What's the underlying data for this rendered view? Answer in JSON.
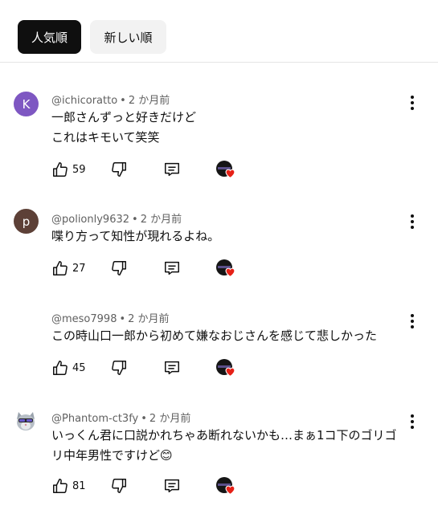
{
  "sort_chips": {
    "top_label": "人気順",
    "newest_label": "新しい順"
  },
  "comments": [
    {
      "avatar_letter": "K",
      "avatar_color": "#7e57c2",
      "handle": "@ichicoratto",
      "time": "2 か月前",
      "lines": [
        "一郎さんずっと好きだけど",
        "これはキモいて笑笑"
      ],
      "likes": "59"
    },
    {
      "avatar_letter": "p",
      "avatar_color": "#5d4037",
      "handle": "@polionly9632",
      "time": "2 か月前",
      "lines": [
        "喋り方って知性が現れるよね。"
      ],
      "likes": "27"
    },
    {
      "avatar_letter": "",
      "avatar_color": "",
      "handle": "@meso7998",
      "time": "2 か月前",
      "lines": [
        "この時山口一郎から初めて嫌なおじさんを感じて悲しかった"
      ],
      "likes": "45"
    },
    {
      "avatar_letter": "",
      "avatar_color": "",
      "handle": "@Phantom-ct3fy",
      "time": "2 か月前",
      "lines": [
        "いっくん君に口説かれちゃあ断れないかも…まぁ1コ下のゴリゴ",
        "リ中年男性ですけど😊"
      ],
      "likes": "81"
    }
  ],
  "icons": {
    "like": "thumbs-up-icon",
    "dislike": "thumbs-down-icon",
    "reply": "reply-comment-icon",
    "creator_heart": "creator-heart-avatar-icon",
    "more": "more-vertical-icon"
  },
  "colors": {
    "heart": "#e62117",
    "meta": "#606060",
    "chip_active": "#0f0f0f",
    "chip_inactive": "#f2f2f2"
  }
}
